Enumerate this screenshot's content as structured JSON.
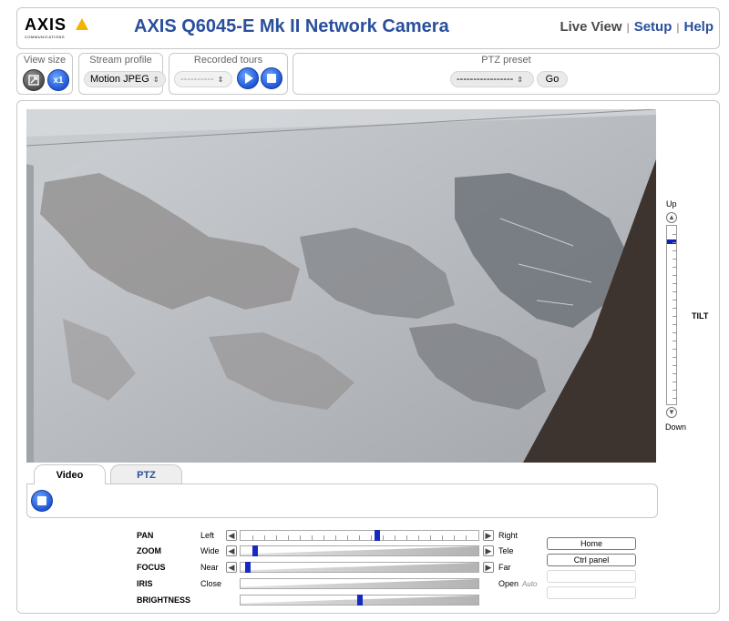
{
  "header": {
    "logo_text": "AXIS",
    "logo_sub": "COMMUNICATIONS",
    "title": "AXIS Q6045-E Mk II Network Camera",
    "nav": [
      {
        "label": "Live View"
      },
      {
        "label": "Setup"
      },
      {
        "label": "Help"
      }
    ],
    "nav_sep": "|"
  },
  "toolbar": {
    "view_size": {
      "label": "View size",
      "x1_label": "x1"
    },
    "stream_profile": {
      "label": "Stream profile",
      "value": "Motion JPEG"
    },
    "recorded_tours": {
      "label": "Recorded tours",
      "value": "----------"
    },
    "ptz_preset": {
      "label": "PTZ preset",
      "value": "-----------------",
      "go_label": "Go"
    }
  },
  "tilt": {
    "up_label": "Up",
    "down_label": "Down",
    "label": "TILT",
    "position_fraction": 0.08
  },
  "tabs": [
    {
      "label": "Video",
      "active": true
    },
    {
      "label": "PTZ",
      "active": false
    }
  ],
  "controls": [
    {
      "name": "PAN",
      "left": "Left",
      "right": "Right",
      "fraction": 0.575,
      "has_buttons": true,
      "style": "ticks"
    },
    {
      "name": "ZOOM",
      "left": "Wide",
      "right": "Tele",
      "fraction": 0.05,
      "has_buttons": true,
      "style": "ramp"
    },
    {
      "name": "FOCUS",
      "left": "Near",
      "right": "Far",
      "fraction": 0.02,
      "has_buttons": true,
      "style": "ramp"
    },
    {
      "name": "IRIS",
      "left": "Close",
      "right": "Open",
      "auto": "Auto",
      "fraction": null,
      "has_buttons": false,
      "style": "ramp"
    },
    {
      "name": "BRIGHTNESS",
      "left": "",
      "right": "",
      "fraction": 0.5,
      "has_buttons": false,
      "style": "ramp"
    }
  ],
  "side_buttons": {
    "home_label": "Home",
    "ctrl_panel_label": "Ctrl panel"
  },
  "icons": {
    "view_size_fit": "resize-icon",
    "view_size_x1": "x1-icon",
    "play": "play-icon",
    "stop": "stop-icon",
    "video_stop": "stop-icon"
  }
}
